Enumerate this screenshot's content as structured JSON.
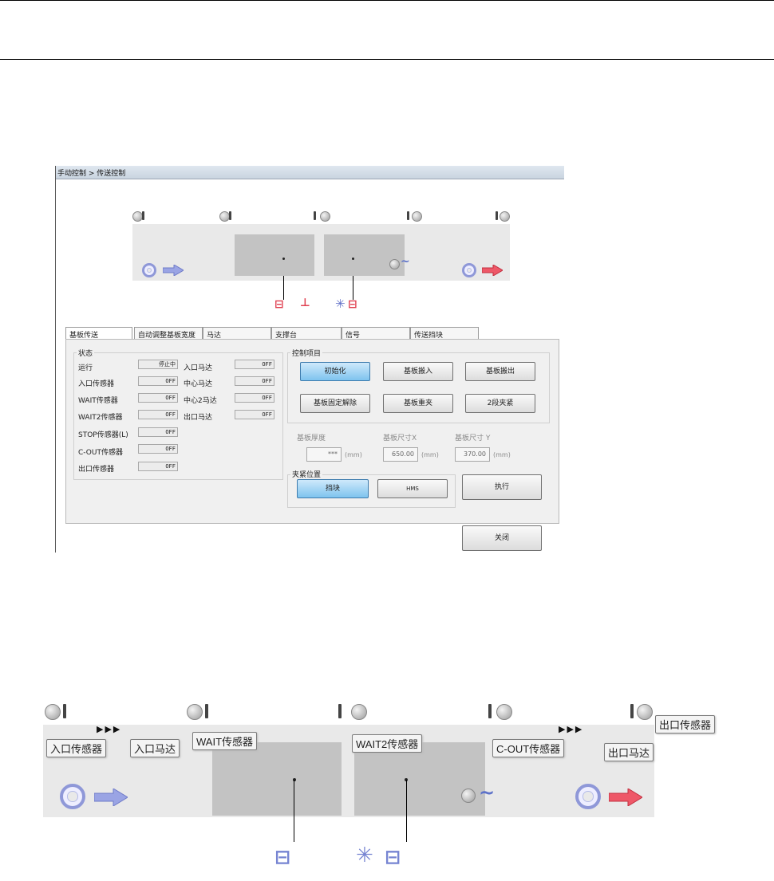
{
  "window": {
    "title": "手动控制 > 传送控制"
  },
  "tabs": [
    {
      "label": "基板传送"
    },
    {
      "label": "自动调整基板宽度"
    },
    {
      "label": "马达"
    },
    {
      "label": "支撑台"
    },
    {
      "label": "信号"
    },
    {
      "label": "传送挡块"
    }
  ],
  "status": {
    "group_label": "状态",
    "rows": [
      {
        "label": "运行",
        "value": "停止中"
      },
      {
        "label": "入口传感器",
        "value": "OFF"
      },
      {
        "label": "WAIT传感器",
        "value": "OFF"
      },
      {
        "label": "WAIT2传感器",
        "value": "OFF"
      },
      {
        "label": "STOP传感器(L)",
        "value": "OFF"
      },
      {
        "label": "C-OUT传感器",
        "value": "OFF"
      },
      {
        "label": "出口传感器",
        "value": "OFF"
      }
    ],
    "motors": [
      {
        "label": "入口马达",
        "value": "OFF"
      },
      {
        "label": "中心马达",
        "value": "OFF"
      },
      {
        "label": "中心2马达",
        "value": "OFF"
      },
      {
        "label": "出口马达",
        "value": "OFF"
      }
    ]
  },
  "control": {
    "group_label": "控制项目",
    "buttons": [
      "初始化",
      "基板搬入",
      "基板搬出",
      "基板固定解除",
      "基板重夹",
      "2段夹紧"
    ],
    "params": [
      {
        "label": "基板厚度",
        "value": "***",
        "unit": "(mm)"
      },
      {
        "label": "基板尺寸X",
        "value": "650.00",
        "unit": "(mm)"
      },
      {
        "label": "基板尺寸 Y",
        "value": "370.00",
        "unit": "(mm)"
      }
    ],
    "clamp_label": "夹紧位置",
    "clamp_options": [
      "挡块",
      "HMS"
    ],
    "execute": "执行"
  },
  "close": "关闭",
  "detail": {
    "callouts": [
      "入口传感器",
      "入口马达",
      "WAIT传感器",
      "WAIT2传感器",
      "C-OUT传感器",
      "出口马达",
      "出口传感器"
    ]
  },
  "colors": {
    "accent": "#7ec3ee",
    "conveyor": "#e9e9e9",
    "stage": "#c3c3c3",
    "arrow_in": "#8f98d8",
    "arrow_out": "#e04050"
  }
}
